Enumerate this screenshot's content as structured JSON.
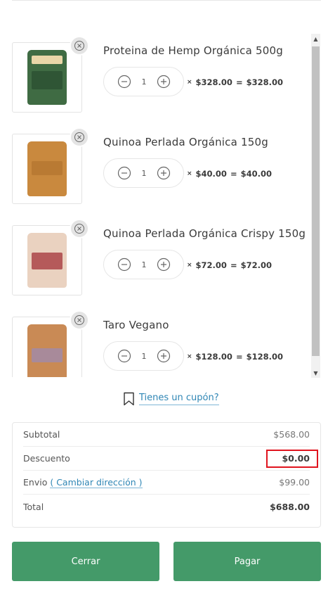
{
  "cart": {
    "items": [
      {
        "title": "Proteina de Hemp Orgánica 500g",
        "qty": "1",
        "unit_price": "$328.00",
        "equals": "=",
        "line_total": "$328.00",
        "times": "×",
        "pouch_color": "#3f6b43",
        "label_color": "#e9d6a8"
      },
      {
        "title": "Quinoa Perlada Orgánica 150g",
        "qty": "1",
        "unit_price": "$40.00",
        "equals": "=",
        "line_total": "$40.00",
        "times": "×",
        "pouch_color": "#c9893e",
        "label_color": "#c9893e"
      },
      {
        "title": "Quinoa Perlada Orgánica Crispy 150g",
        "qty": "1",
        "unit_price": "$72.00",
        "equals": "=",
        "line_total": "$72.00",
        "times": "×",
        "pouch_color": "#e8c8b4",
        "label_color": "#b55a5a"
      },
      {
        "title": "Taro Vegano",
        "qty": "1",
        "unit_price": "$128.00",
        "equals": "=",
        "line_total": "$128.00",
        "times": "×",
        "pouch_color": "#c98a55",
        "label_color": "#a88a9a"
      }
    ]
  },
  "coupon": {
    "label": "Tienes un cupón?"
  },
  "totals": {
    "subtotal_label": "Subtotal",
    "subtotal_value": "$568.00",
    "discount_label": "Descuento",
    "discount_value": "$0.00",
    "shipping_label": "Envio",
    "shipping_change": "( Cambiar dirección )",
    "shipping_value": "$99.00",
    "total_label": "Total",
    "total_value": "$688.00"
  },
  "actions": {
    "close_label": "Cerrar",
    "pay_label": "Pagar"
  },
  "colors": {
    "accent": "#449a69",
    "link": "#2f86b5",
    "highlight": "#e0141e"
  }
}
